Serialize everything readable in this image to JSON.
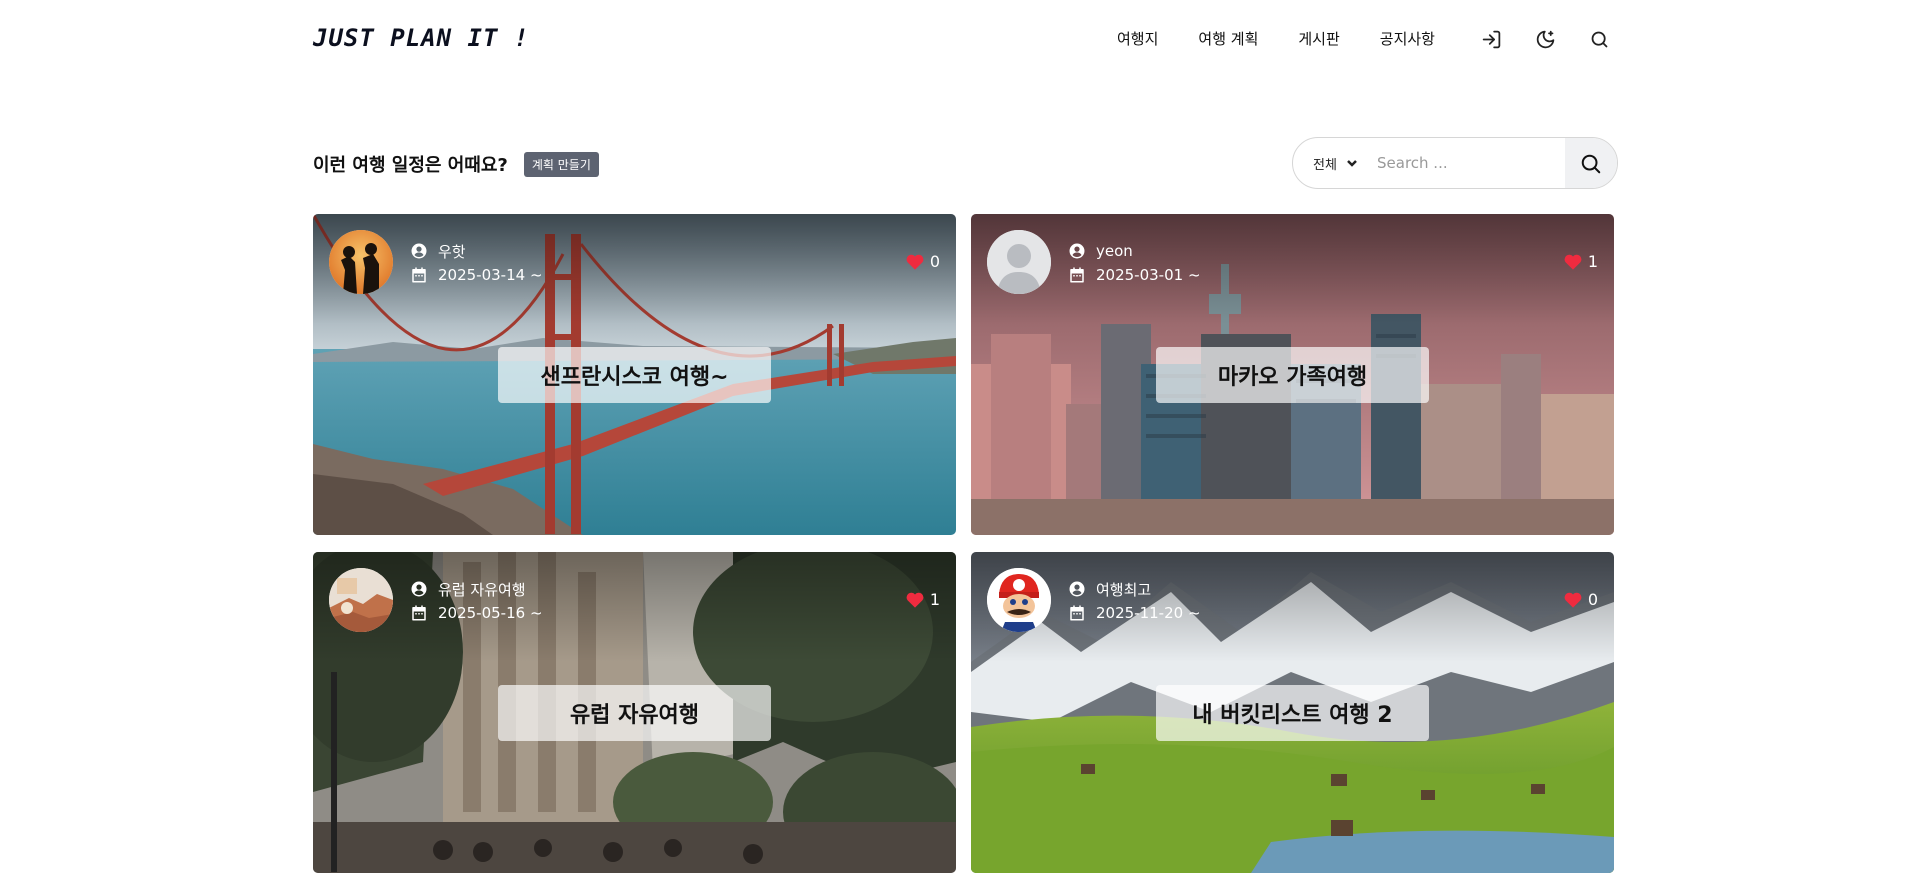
{
  "header": {
    "logo": "JUST PLAN IT !",
    "nav": [
      "여행지",
      "여행 계획",
      "게시판",
      "공지사항"
    ],
    "icons": [
      "login-icon",
      "dark-mode-icon",
      "search-icon"
    ]
  },
  "section": {
    "title": "이런 여행 일정은 어때요?",
    "create_button": "계획 만들기"
  },
  "search": {
    "filter": "전체",
    "placeholder": "Search ..."
  },
  "colors": {
    "heart": "#ef2b3f",
    "badge": "#5d6371"
  },
  "cards": [
    {
      "author": "우핫",
      "date": "2025-03-14 ~",
      "likes": "0",
      "title": "샌프란시스코 여행~"
    },
    {
      "author": "yeon",
      "date": "2025-03-01 ~",
      "likes": "1",
      "title": "마카오 가족여행"
    },
    {
      "author": "유럽 자유여행",
      "date": "2025-05-16 ~",
      "likes": "1",
      "title": "유럽 자유여행"
    },
    {
      "author": "여행최고",
      "date": "2025-11-20 ~",
      "likes": "0",
      "title": "내 버킷리스트 여행 2"
    }
  ]
}
